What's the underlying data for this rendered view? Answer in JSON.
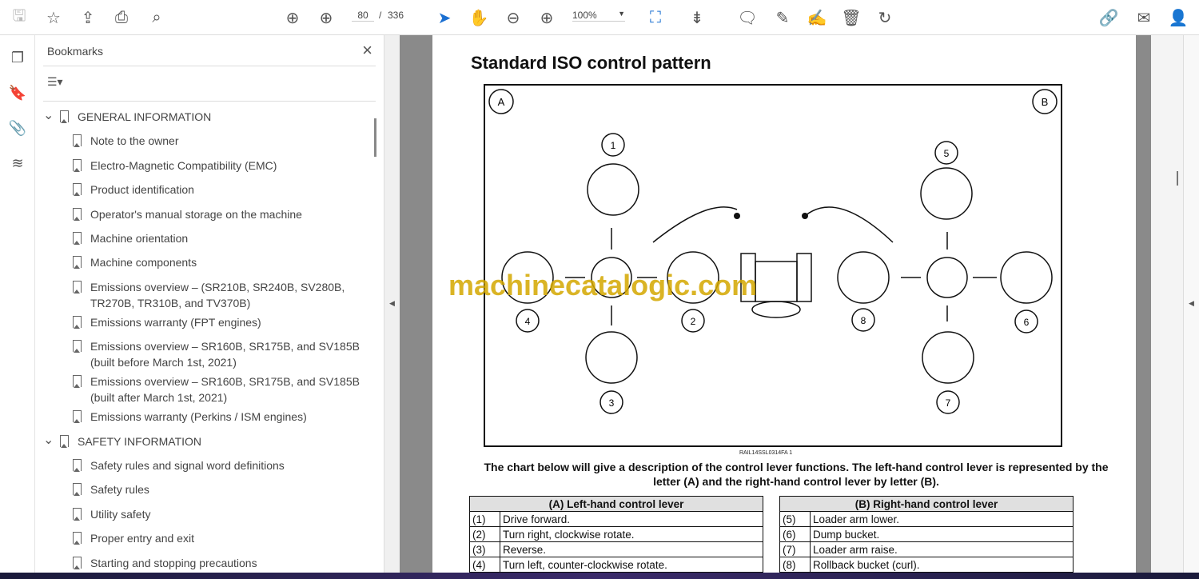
{
  "toolbar": {
    "page_current": "80",
    "page_sep": "/",
    "page_total": "336",
    "zoom": "100%"
  },
  "bookmarks": {
    "title": "Bookmarks",
    "items": [
      {
        "label": "GENERAL INFORMATION",
        "level": 0
      },
      {
        "label": "Note to the owner",
        "level": 1
      },
      {
        "label": "Electro-Magnetic Compatibility (EMC)",
        "level": 1
      },
      {
        "label": "Product identification",
        "level": 1
      },
      {
        "label": "Operator's manual storage on the machine",
        "level": 1
      },
      {
        "label": "Machine orientation",
        "level": 1
      },
      {
        "label": "Machine components",
        "level": 1
      },
      {
        "label": "Emissions overview  – (SR210B, SR240B, SV280B,",
        "label2": "TR270B, TR310B, and TV370B)",
        "level": 1
      },
      {
        "label": "Emissions warranty (FPT engines)",
        "level": 1
      },
      {
        "label": "Emissions overview  – SR160B, SR175B, and SV185B",
        "label2": "(built before March 1st, 2021)",
        "level": 1
      },
      {
        "label": "Emissions overview  – SR160B, SR175B, and SV185B",
        "label2": "(built after March 1st, 2021)",
        "level": 1
      },
      {
        "label": "Emissions warranty (Perkins / ISM engines)",
        "level": 1
      },
      {
        "label": "SAFETY INFORMATION",
        "level": 0
      },
      {
        "label": "Safety rules and signal word definitions",
        "level": 1
      },
      {
        "label": "Safety rules",
        "level": 1
      },
      {
        "label": "Utility safety",
        "level": 1
      },
      {
        "label": "Proper entry and exit",
        "level": 1
      },
      {
        "label": "Starting and stopping precautions",
        "level": 1
      }
    ]
  },
  "doc": {
    "heading": "Standard ISO control pattern",
    "figure": {
      "label_a": "A",
      "label_b": "B",
      "numbers": [
        "1",
        "2",
        "3",
        "4",
        "5",
        "6",
        "7",
        "8"
      ],
      "code": "RAIL14SSL0314FA    1"
    },
    "watermark": "machinecatalogic.com",
    "desc": "The chart below will give a description of the control lever functions.  The left-hand control lever is represented by the letter (A) and the right-hand control lever by letter (B).",
    "table_a": {
      "header": "(A) Left-hand control lever",
      "rows": [
        [
          "(1)",
          "Drive forward."
        ],
        [
          "(2)",
          "Turn right, clockwise rotate."
        ],
        [
          "(3)",
          "Reverse."
        ],
        [
          "(4)",
          "Turn left, counter-clockwise rotate."
        ]
      ]
    },
    "table_b": {
      "header": "(B) Right-hand control lever",
      "rows": [
        [
          "(5)",
          "Loader arm lower."
        ],
        [
          "(6)",
          "Dump bucket."
        ],
        [
          "(7)",
          "Loader arm raise."
        ],
        [
          "(8)",
          "Rollback bucket (curl)."
        ]
      ]
    }
  }
}
